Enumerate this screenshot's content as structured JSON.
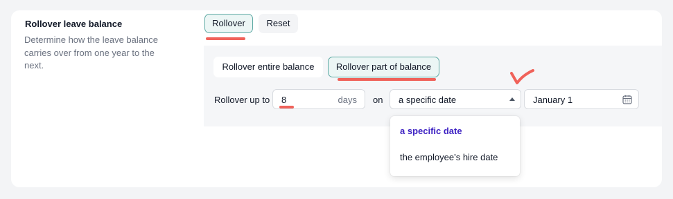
{
  "section": {
    "title": "Rollover leave balance",
    "description": "Determine how the leave balance carries over from one year to the next."
  },
  "mode_toggle": {
    "rollover_label": "Rollover",
    "reset_label": "Reset",
    "selected": "Rollover"
  },
  "rollover_type": {
    "entire_label": "Rollover entire balance",
    "part_label": "Rollover part of balance",
    "selected": "Rollover part of balance"
  },
  "rollover_form": {
    "prefix_label": "Rollover up to",
    "amount_value": "8",
    "amount_unit": "days",
    "on_label": "on",
    "date_type_value": "a specific date",
    "date_value": "January 1"
  },
  "date_type_dropdown": {
    "options": [
      "a specific date",
      "the employee’s hire date"
    ],
    "selected": "a specific date"
  },
  "icons": {
    "calendar": "calendar-icon",
    "caret": "caret-up-icon"
  },
  "colors": {
    "accent_border": "#5eaaa4",
    "accent_bg": "#ecf6f5",
    "selected_option": "#3b1fc2",
    "annotation": "#f0625a"
  }
}
